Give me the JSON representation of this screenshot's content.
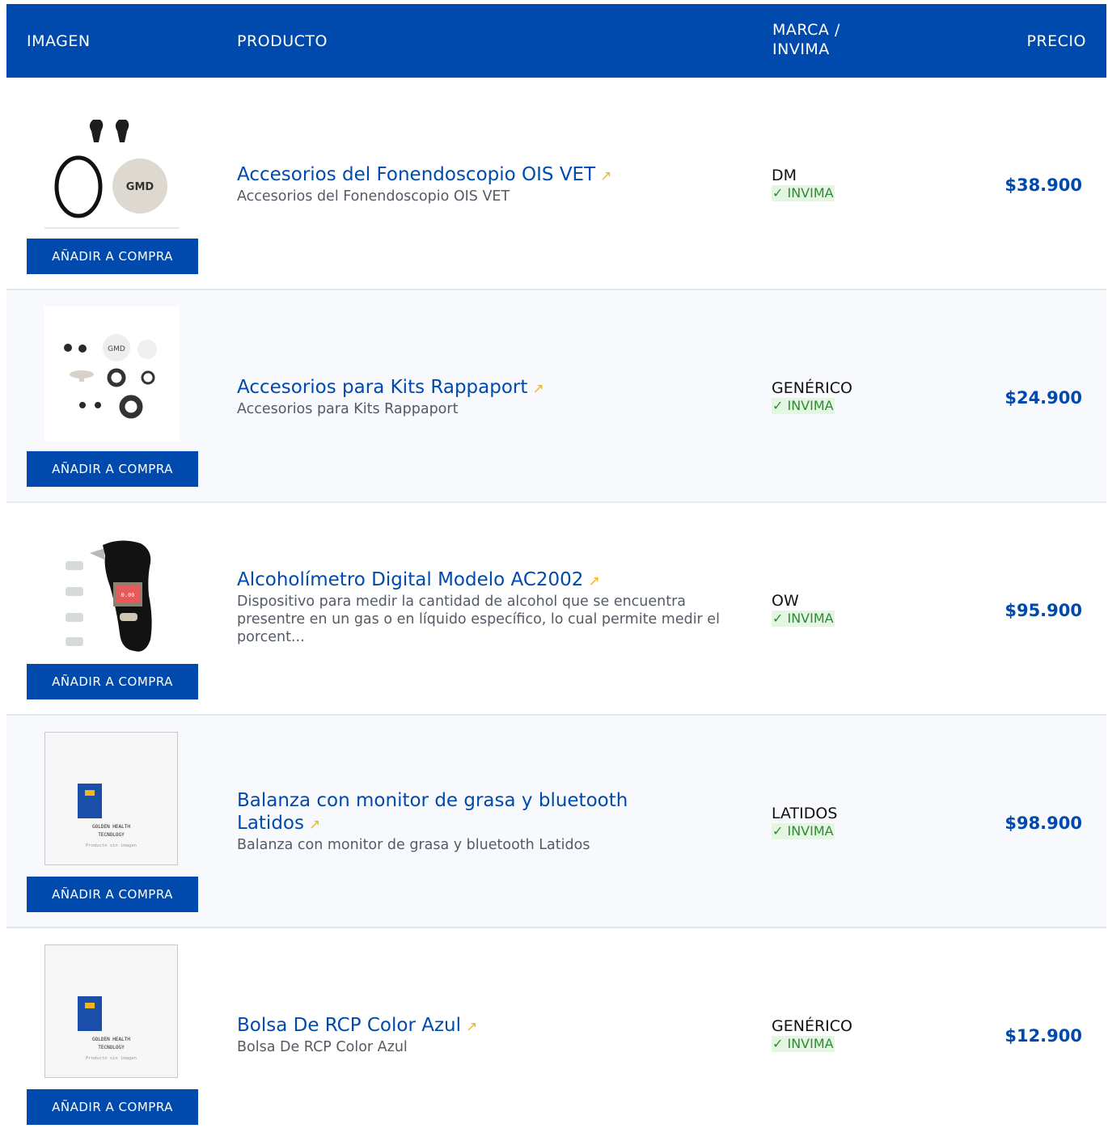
{
  "header": {
    "col_image": "IMAGEN",
    "col_product": "PRODUCTO",
    "col_brand_line1": "MARCA /",
    "col_brand_line2": "INVIMA",
    "col_price": "PRECIO"
  },
  "colors": {
    "primary": "#004aad",
    "accent": "#f2b51c",
    "invima_bg": "#e4f5e2",
    "invima_text": "#2e8a36"
  },
  "products": [
    {
      "name": "Accesorios del Fonendoscopio OIS VET",
      "arrow": "↗",
      "description": "Accesorios del Fonendoscopio OIS VET",
      "brand": "DM",
      "invima": "✓ INVIMA",
      "price": "$38.900",
      "button": "AÑADIR A COMPRA",
      "image": "stethoscope-accessories-image"
    },
    {
      "name": "Accesorios para Kits Rappaport",
      "arrow": "↗",
      "description": "Accesorios para Kits Rappaport",
      "brand": "GENÉRICO",
      "invima": "✓ INVIMA",
      "price": "$24.900",
      "button": "AÑADIR A COMPRA",
      "image": "rappaport-accessories-image"
    },
    {
      "name": "Alcoholímetro Digital Modelo AC2002",
      "arrow": "↗",
      "description": "Dispositivo para medir la cantidad de alcohol que se encuentra presentre en un gas o en líquido específico, lo cual permite medir el porcent...",
      "brand": "OW",
      "invima": "✓ INVIMA",
      "price": "$95.900",
      "button": "AÑADIR A COMPRA",
      "image": "breathalyzer-image"
    },
    {
      "name": "Balanza con monitor de grasa y bluetooth Latidos",
      "arrow": "↗",
      "description": "Balanza con monitor de grasa y bluetooth Latidos",
      "brand": "LATIDOS",
      "invima": "✓ INVIMA",
      "price": "$98.900",
      "button": "AÑADIR A COMPRA",
      "image": "no-image-placeholder",
      "placeholder": {
        "line1": "GOLDEN HEALTH",
        "line2": "TECNOLOGY",
        "line3": "Producto sin imagen"
      }
    },
    {
      "name": "Bolsa De RCP Color Azul",
      "arrow": "↗",
      "description": "Bolsa De RCP Color Azul",
      "brand": "GENÉRICO",
      "invima": "✓ INVIMA",
      "price": "$12.900",
      "button": "AÑADIR A COMPRA",
      "image": "no-image-placeholder",
      "placeholder": {
        "line1": "GOLDEN HEALTH",
        "line2": "TECNOLOGY",
        "line3": "Producto sin imagen"
      }
    }
  ]
}
